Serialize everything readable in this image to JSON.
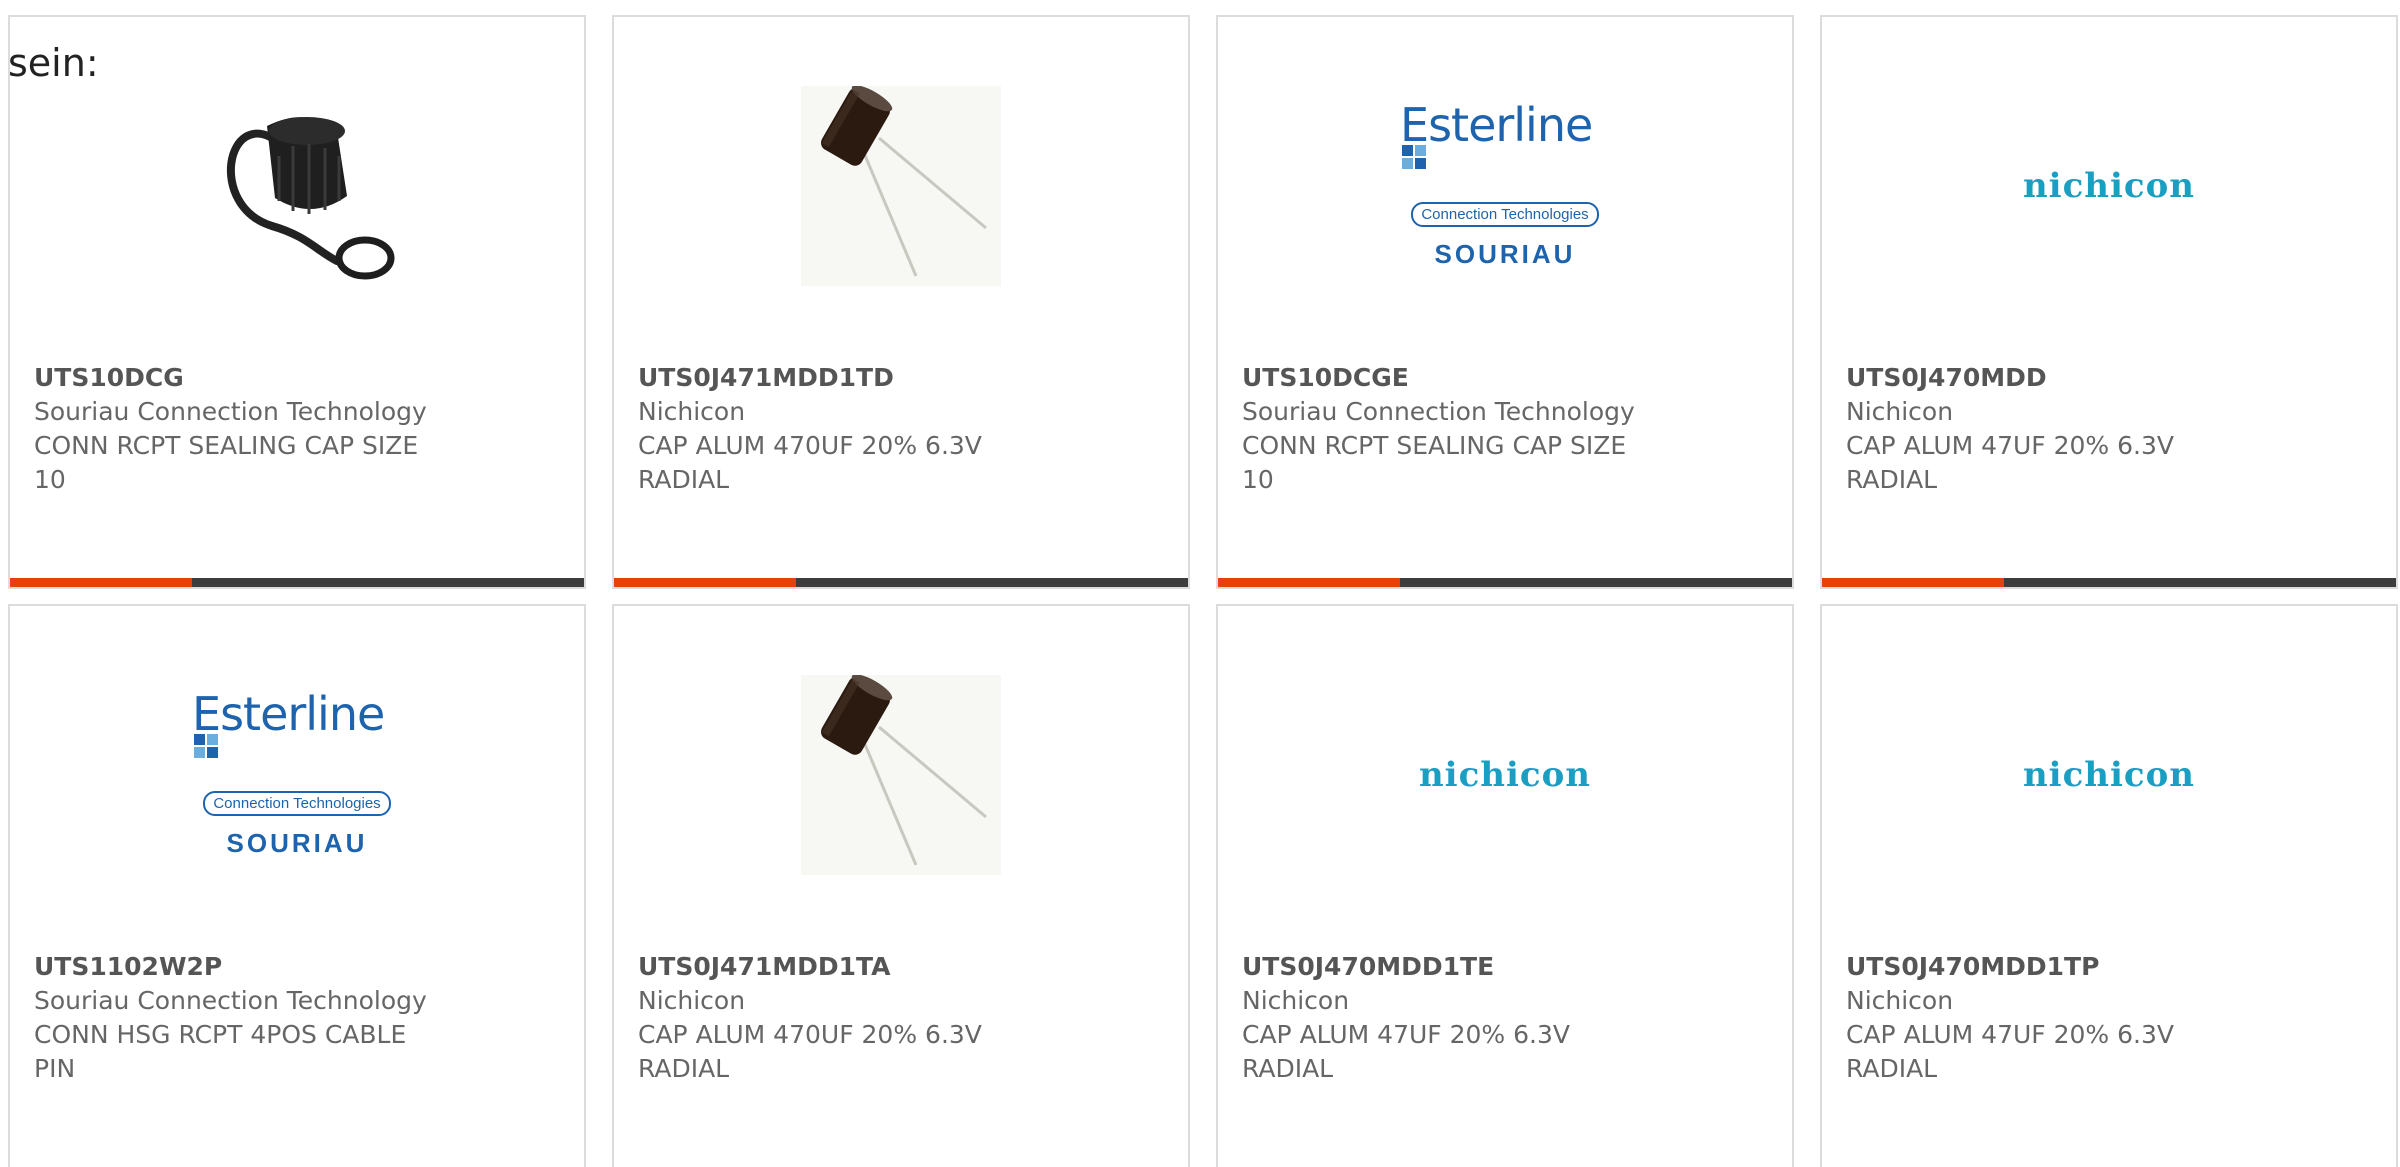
{
  "intro": {
    "text": "sein:"
  },
  "products": [
    {
      "part_number": "UTS10DCG",
      "manufacturer": "Souriau Connection Technology",
      "description_line1": "CONN RCPT SEALING CAP SIZE",
      "description_line2": "10",
      "image": "sealing-cap-photo"
    },
    {
      "part_number": "UTS0J471MDD1TD",
      "manufacturer": "Nichicon",
      "description_line1": "CAP ALUM 470UF 20% 6.3V",
      "description_line2": "RADIAL",
      "image": "capacitor-photo"
    },
    {
      "part_number": "UTS10DCGE",
      "manufacturer": "Souriau Connection Technology",
      "description_line1": "CONN RCPT SEALING CAP SIZE",
      "description_line2": "10",
      "image": "esterline-souriau-logo"
    },
    {
      "part_number": "UTS0J470MDD",
      "manufacturer": "Nichicon",
      "description_line1": "CAP ALUM 47UF 20% 6.3V",
      "description_line2": "RADIAL",
      "image": "nichicon-logo"
    },
    {
      "part_number": "UTS1102W2P",
      "manufacturer": "Souriau Connection Technology",
      "description_line1": "CONN HSG RCPT 4POS CABLE",
      "description_line2": "PIN",
      "image": "esterline-souriau-logo"
    },
    {
      "part_number": "UTS0J471MDD1TA",
      "manufacturer": "Nichicon",
      "description_line1": "CAP ALUM 470UF 20% 6.3V",
      "description_line2": "RADIAL",
      "image": "capacitor-photo"
    },
    {
      "part_number": "UTS0J470MDD1TE",
      "manufacturer": "Nichicon",
      "description_line1": "CAP ALUM 47UF 20% 6.3V",
      "description_line2": "RADIAL",
      "image": "nichicon-logo"
    },
    {
      "part_number": "UTS0J470MDD1TP",
      "manufacturer": "Nichicon",
      "description_line1": "CAP ALUM 47UF 20% 6.3V",
      "description_line2": "RADIAL",
      "image": "nichicon-logo"
    }
  ],
  "logos": {
    "esterline": {
      "word": "Esterline",
      "sub": "Connection Technologies",
      "brand": "SOURIAU"
    },
    "nichicon": {
      "word": "nichicon"
    }
  },
  "colors": {
    "accent": "#e8400c",
    "bar": "#3d3d3d",
    "esterline_blue": "#1d63ad",
    "nichicon_teal": "#1a9ec2"
  }
}
